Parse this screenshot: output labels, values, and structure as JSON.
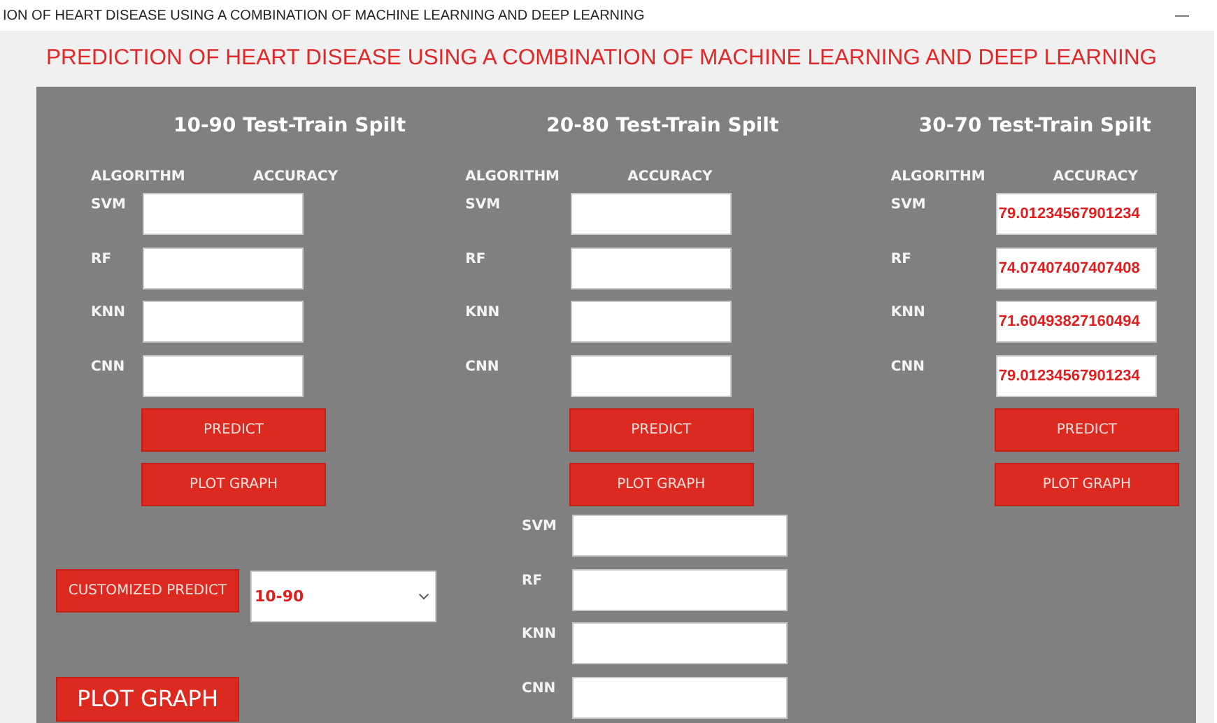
{
  "window": {
    "title": "ION OF HEART DISEASE USING A COMBINATION OF MACHINE LEARNING AND DEEP LEARNING",
    "minimize": "—"
  },
  "heading": "PREDICTION OF HEART DISEASE USING A COMBINATION OF MACHINE LEARNING AND DEEP LEARNING",
  "splits": [
    {
      "title": "10-90 Test-Train Spilt",
      "algorithm_header": "ALGORITHM",
      "accuracy_header": "ACCURACY",
      "rows": [
        {
          "algorithm": "SVM"
        },
        {
          "algorithm": "RF"
        },
        {
          "algorithm": "KNN"
        },
        {
          "algorithm": "CNN"
        }
      ],
      "buttons": [
        "PREDICT",
        "PLOT GRAPH"
      ]
    },
    {
      "title": "20-80 Test-Train Spilt",
      "algorithm_header": "ALGORITHM",
      "accuracy_header": "ACCURACY",
      "rows": [
        {
          "algorithm": "SVM"
        },
        {
          "algorithm": "RF"
        },
        {
          "algorithm": "KNN"
        },
        {
          "algorithm": "CNN"
        }
      ],
      "buttons": [
        "PREDICT",
        "PLOT GRAPH"
      ]
    },
    {
      "title": "30-70 Test-Train Spilt",
      "algorithm_header": "ALGORITHM",
      "accuracy_header": "ACCURACY",
      "rows": [
        {
          "algorithm": "SVM",
          "accuracy": "79.01234567901234"
        },
        {
          "algorithm": "RF",
          "accuracy": "74.07407407407408"
        },
        {
          "algorithm": "KNN",
          "accuracy": "71.60493827160494"
        },
        {
          "algorithm": "CNN",
          "accuracy": "79.01234567901234"
        }
      ],
      "buttons": [
        "PREDICT",
        "PLOT GRAPH"
      ]
    }
  ],
  "custom": {
    "predict_button": "CUSTOMIZED PREDICT",
    "split_select": {
      "value": "10-90"
    },
    "plot_button": "PLOT GRAPH",
    "results": [
      {
        "algorithm": "SVM"
      },
      {
        "algorithm": "RF"
      },
      {
        "algorithm": "KNN"
      },
      {
        "algorithm": "CNN"
      }
    ]
  }
}
